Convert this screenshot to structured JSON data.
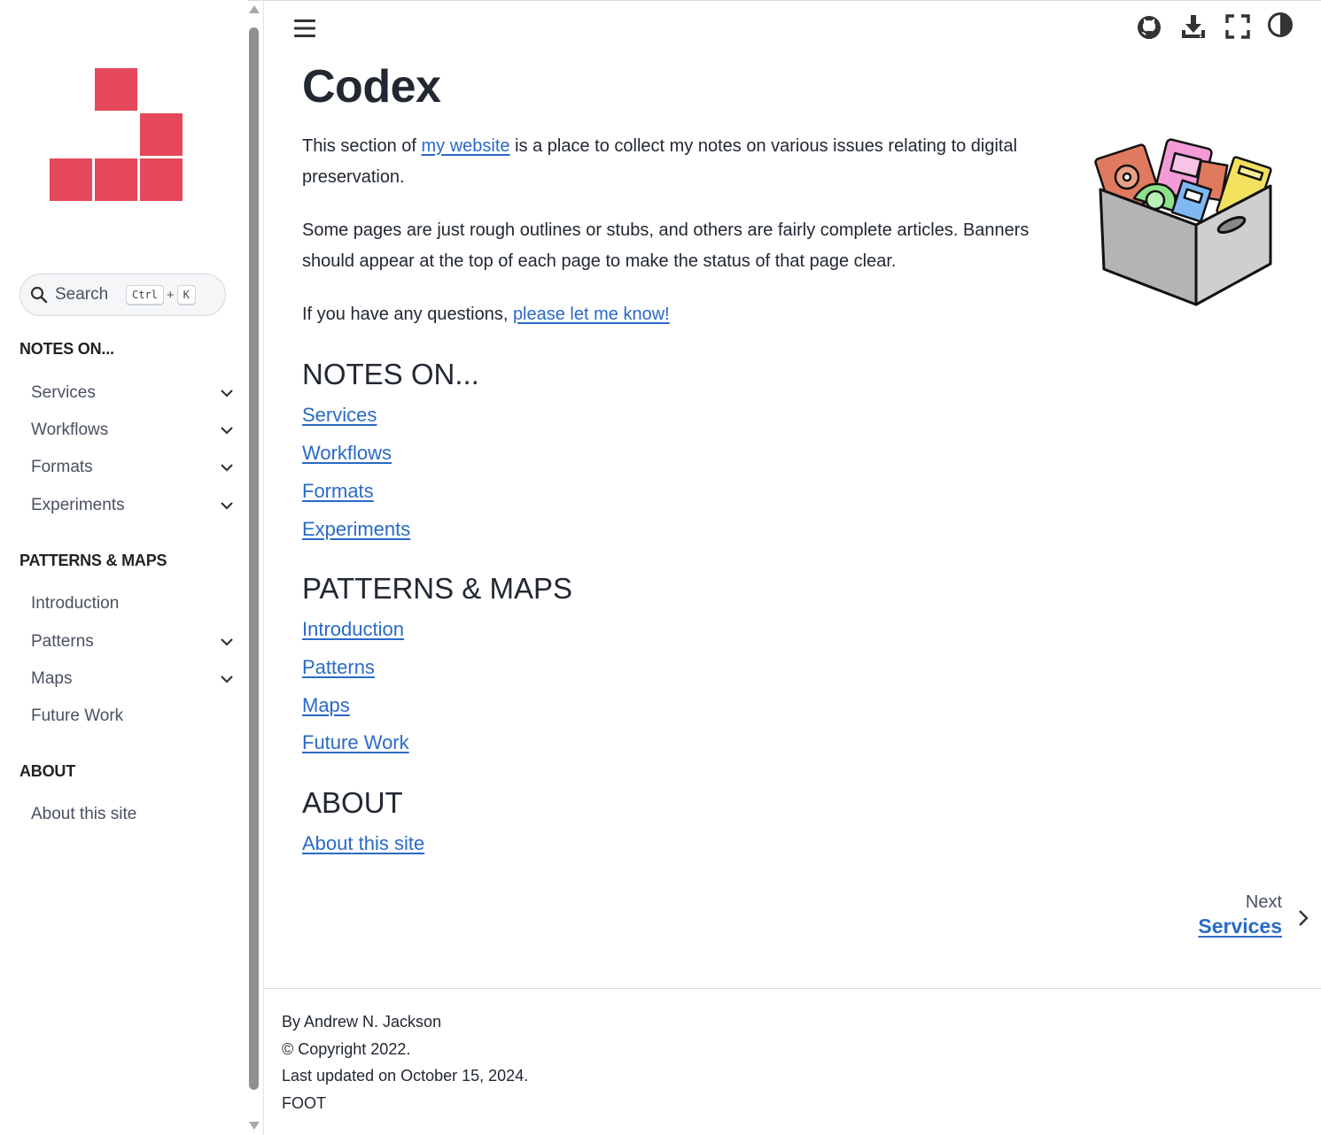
{
  "sidebar": {
    "search": {
      "label": "Search",
      "shortcut_key1": "Ctrl",
      "shortcut_plus": "+",
      "shortcut_key2": "K"
    },
    "sections": [
      {
        "caption": "NOTES ON...",
        "items": [
          {
            "label": "Services",
            "expandable": true
          },
          {
            "label": "Workflows",
            "expandable": true
          },
          {
            "label": "Formats",
            "expandable": true
          },
          {
            "label": "Experiments",
            "expandable": true
          }
        ]
      },
      {
        "caption": "PATTERNS & MAPS",
        "items": [
          {
            "label": "Introduction",
            "expandable": false
          },
          {
            "label": "Patterns",
            "expandable": true
          },
          {
            "label": "Maps",
            "expandable": true
          },
          {
            "label": "Future Work",
            "expandable": false
          }
        ]
      },
      {
        "caption": "ABOUT",
        "items": [
          {
            "label": "About this site",
            "expandable": false
          }
        ]
      }
    ]
  },
  "header": {
    "icons": [
      "menu-icon",
      "github-icon",
      "download-icon",
      "fullscreen-icon",
      "theme-toggle-icon"
    ]
  },
  "main": {
    "title": "Codex",
    "intro": {
      "before": "This section of ",
      "link": "my website",
      "after": " is a place to collect my notes on various issues relating to digital preservation."
    },
    "para2": "Some pages are just rough outlines or stubs, and others are fairly complete articles. Banners should appear at the top of each page to make the status of that page clear.",
    "para3": {
      "before": "If you have any questions, ",
      "link": "please let me know!"
    },
    "sections": [
      {
        "heading": "NOTES ON...",
        "links": [
          "Services",
          "Workflows",
          "Formats",
          "Experiments"
        ]
      },
      {
        "heading": "PATTERNS & MAPS",
        "links": [
          "Introduction",
          "Patterns",
          "Maps",
          "Future Work"
        ]
      },
      {
        "heading": "ABOUT",
        "links": [
          "About this site"
        ]
      }
    ],
    "next": {
      "label": "Next",
      "title": "Services"
    }
  },
  "footer": {
    "author": "By Andrew N. Jackson",
    "copyright": "© Copyright 2022.",
    "updated": "Last updated on October 15, 2024.",
    "extra": "FOOT"
  },
  "colors": {
    "brand": "#e5485a",
    "link": "#2a6ac7",
    "text": "#222832"
  }
}
